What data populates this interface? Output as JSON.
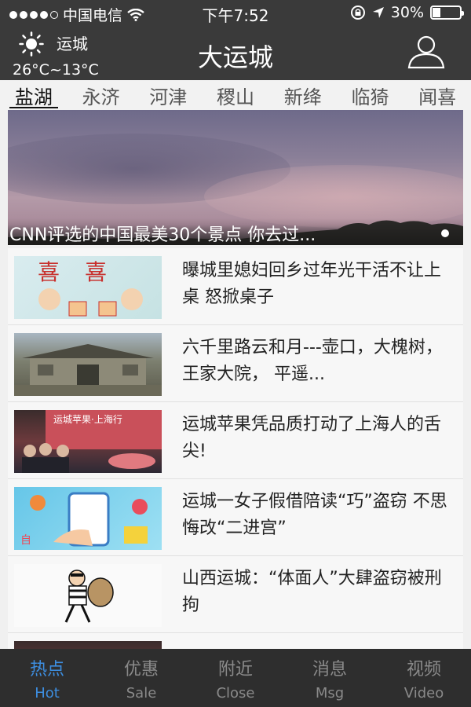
{
  "status_bar": {
    "carrier": "中国电信",
    "time": "下午7:52",
    "battery_text": "30%",
    "battery_level": 0.3,
    "icons": [
      "signal-dots-icon",
      "wifi-icon",
      "orientation-lock-icon",
      "location-arrow-icon",
      "battery-icon"
    ]
  },
  "header": {
    "city": "运城",
    "temperature": "26°C~13°C",
    "title": "大运城",
    "icons": [
      "sun-icon",
      "user-icon"
    ]
  },
  "region_tabs": [
    {
      "label": "盐湖",
      "active": true
    },
    {
      "label": "永济",
      "active": false
    },
    {
      "label": "河津",
      "active": false
    },
    {
      "label": "稷山",
      "active": false
    },
    {
      "label": "新绛",
      "active": false
    },
    {
      "label": "临猗",
      "active": false
    },
    {
      "label": "闻喜",
      "active": false
    }
  ],
  "banner": {
    "caption": "CNN评选的中国最美30个景点 你去过..."
  },
  "news": [
    {
      "headline": "曝城里媳妇回乡过年光干活不让上桌 怒掀桌子"
    },
    {
      "headline": "六千里路云和月---壶口，大槐树， 王家大院， 平遥..."
    },
    {
      "headline": "运城苹果凭品质打动了上海人的舌尖!"
    },
    {
      "headline": "运城一女子假借陪读“巧”盗窃 不思悔改“二进宫”"
    },
    {
      "headline": "山西运城：“体面人”大肆盗窃被刑拘"
    }
  ],
  "tab_bar": [
    {
      "zh": "热点",
      "en": "Hot",
      "active": true
    },
    {
      "zh": "优惠",
      "en": "Sale",
      "active": false
    },
    {
      "zh": "附近",
      "en": "Close",
      "active": false
    },
    {
      "zh": "消息",
      "en": "Msg",
      "active": false
    },
    {
      "zh": "视频",
      "en": "Video",
      "active": false
    }
  ],
  "colors": {
    "header_bg": "#3a3a3a",
    "tabbar_bg": "#2e2e2e",
    "tabbar_active": "#3d8ee0",
    "tabbar_inactive": "#8a8a8a"
  }
}
